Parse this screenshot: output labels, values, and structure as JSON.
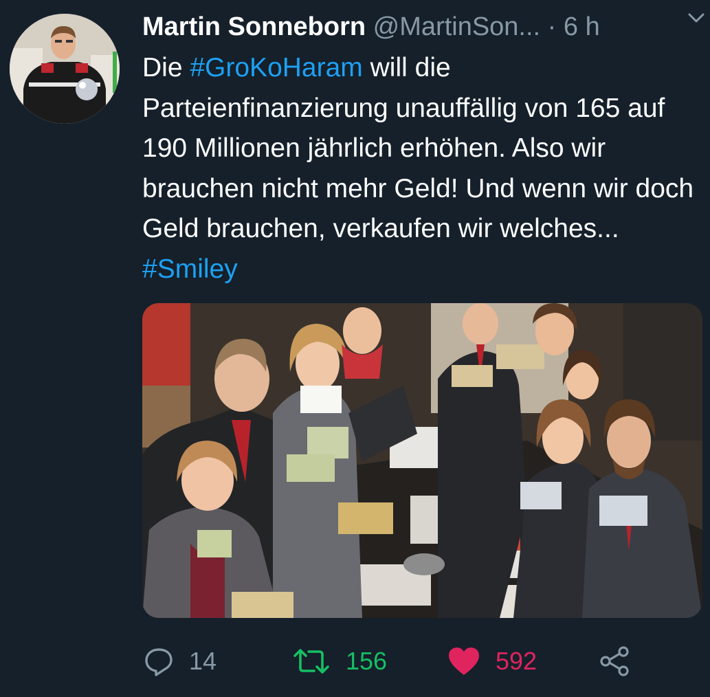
{
  "tweet": {
    "display_name": "Martin Sonneborn",
    "handle": "@MartinSon...",
    "separator": "·",
    "time": "6 h",
    "text_parts": {
      "p1": "Die ",
      "hashtag1": "#GroKoHaram",
      "p2": " will die Parteienfinanzierung unauffällig von 165 auf 190 Millionen jährlich erhöhen. Also wir brauchen nicht mehr Geld! Und wenn wir doch Geld brauchen, verkaufen wir welches... ",
      "hashtag2": "#Smiley"
    }
  },
  "actions": {
    "reply_count": "14",
    "retweet_count": "156",
    "like_count": "592"
  },
  "icons": {
    "reply": "reply-icon",
    "retweet": "retweet-icon",
    "like": "heart-icon",
    "share": "share-icon",
    "menu": "chevron-down-icon"
  },
  "colors": {
    "background": "#15202b",
    "text": "#ffffff",
    "secondary": "#8899a6",
    "link": "#1da1f2",
    "retweet": "#17bf63",
    "like": "#e0245e"
  }
}
